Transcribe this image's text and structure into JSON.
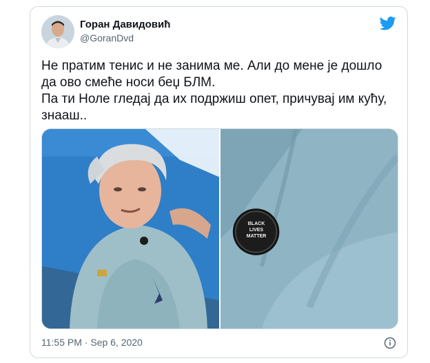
{
  "tweet": {
    "author_name": "Горан Давидовић",
    "author_handle": "@GoranDvd",
    "text_line_1": "Не пратим тенис и не занима ме. Али до мене је дошло да ово смеће носи беџ БЛМ.",
    "text_line_2": "Па ти Ноле гледај да их подржиш опет, причувај им кућу, знааш..",
    "timestamp": "11:55 PM · Sep 6, 2020",
    "platform_icon": "twitter-bird-icon",
    "info_icon": "info-icon"
  },
  "media": {
    "badge_text": "BLACK LIVES MATTER"
  },
  "colors": {
    "brand": "#1d9bf0",
    "text_primary": "#0f1419",
    "text_secondary": "#536471",
    "border": "#cfd9de"
  }
}
